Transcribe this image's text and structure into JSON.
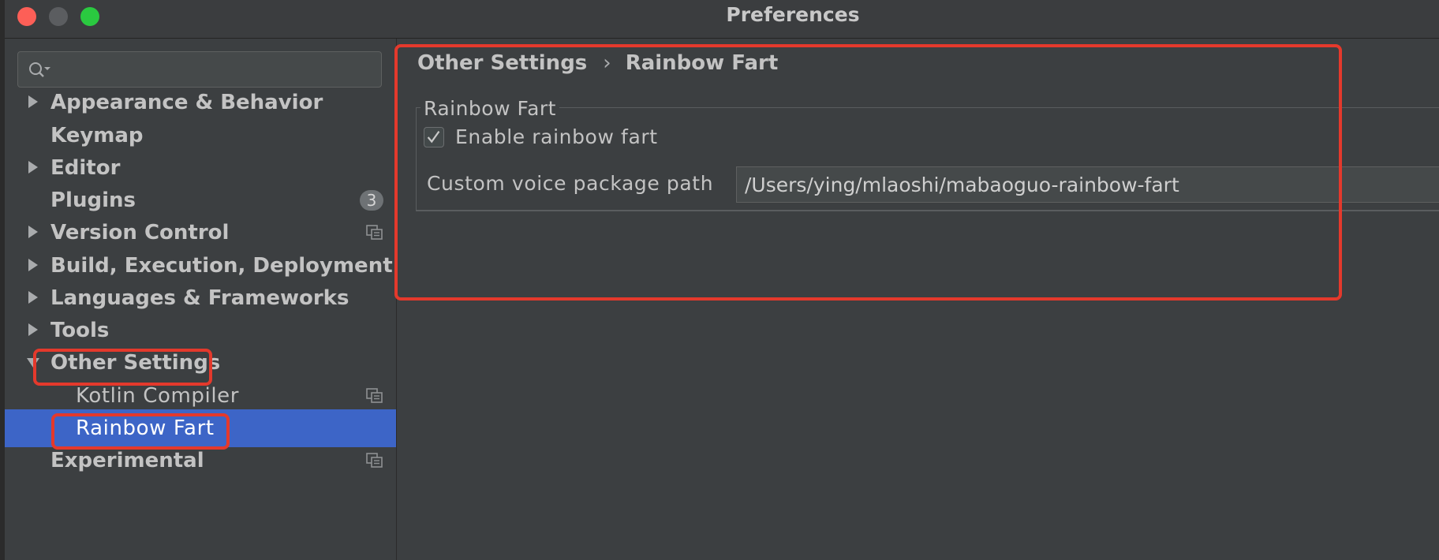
{
  "window": {
    "title": "Preferences"
  },
  "sidebar": {
    "search": {
      "placeholder": "",
      "value": ""
    },
    "items": [
      {
        "label": "Appearance & Behavior",
        "expandable": true
      },
      {
        "label": "Keymap",
        "expandable": false
      },
      {
        "label": "Editor",
        "expandable": true
      },
      {
        "label": "Plugins",
        "expandable": false,
        "badge": "3"
      },
      {
        "label": "Version Control",
        "expandable": true
      },
      {
        "label": "Build, Execution, Deployment",
        "expandable": true
      },
      {
        "label": "Languages & Frameworks",
        "expandable": true
      },
      {
        "label": "Tools",
        "expandable": true
      },
      {
        "label": "Other Settings",
        "expanded": true
      },
      {
        "label": "Kotlin Compiler",
        "child": true
      },
      {
        "label": "Rainbow Fart",
        "child": true,
        "selected": true
      },
      {
        "label": "Experimental",
        "expandable": false
      }
    ]
  },
  "main": {
    "breadcrumb": {
      "parent": "Other Settings",
      "separator": "›",
      "current": "Rainbow Fart"
    },
    "group": {
      "title": "Rainbow Fart",
      "enable_label": "Enable rainbow fart",
      "enable_checked": true,
      "path_label": "Custom voice package path",
      "path_value": "/Users/ying/mlaoshi/mabaoguo-rainbow-fart"
    }
  },
  "colors": {
    "selection": "#3d65c7",
    "annotation": "#e4392c",
    "background": "#3c3f41"
  }
}
